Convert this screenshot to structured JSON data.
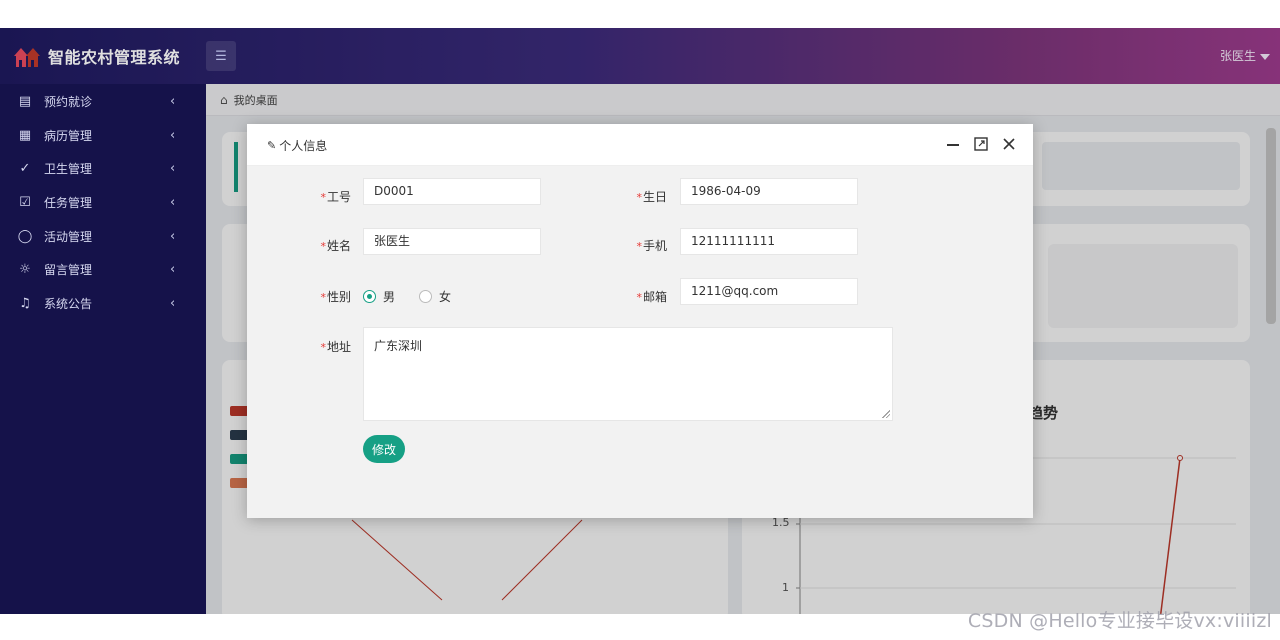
{
  "app": {
    "title": "智能农村管理系统"
  },
  "header": {
    "user_name": "张医生"
  },
  "sidebar": {
    "items": [
      {
        "label": "预约就诊",
        "icon": "calendar-icon"
      },
      {
        "label": "病历管理",
        "icon": "medical-record-icon"
      },
      {
        "label": "卫生管理",
        "icon": "hygiene-icon"
      },
      {
        "label": "任务管理",
        "icon": "task-icon"
      },
      {
        "label": "活动管理",
        "icon": "lightbulb-icon"
      },
      {
        "label": "留言管理",
        "icon": "message-icon"
      },
      {
        "label": "系统公告",
        "icon": "bell-icon"
      }
    ]
  },
  "breadcrumb": {
    "home": "我的桌面"
  },
  "background": {
    "chart_title_fragment": "趋势",
    "yticks": [
      "1.5",
      "1"
    ]
  },
  "dialog": {
    "title": "个人信息",
    "fields": {
      "job_no": {
        "label": "工号",
        "value": "D0001"
      },
      "birthday": {
        "label": "生日",
        "value": "1986-04-09"
      },
      "name": {
        "label": "姓名",
        "value": "张医生"
      },
      "phone": {
        "label": "手机",
        "value": "12111111111"
      },
      "gender": {
        "label": "性别",
        "options": [
          "男",
          "女"
        ],
        "selected": "男"
      },
      "email": {
        "label": "邮箱",
        "value": "1211@qq.com"
      },
      "address": {
        "label": "地址",
        "value": "广东深圳"
      }
    },
    "submit_label": "修改"
  },
  "watermark": "CSDN @Hello专业接毕设vx:viiiizl",
  "colors": {
    "accent": "#16a085",
    "sidebar": "#15124a",
    "required": "#e53935"
  }
}
